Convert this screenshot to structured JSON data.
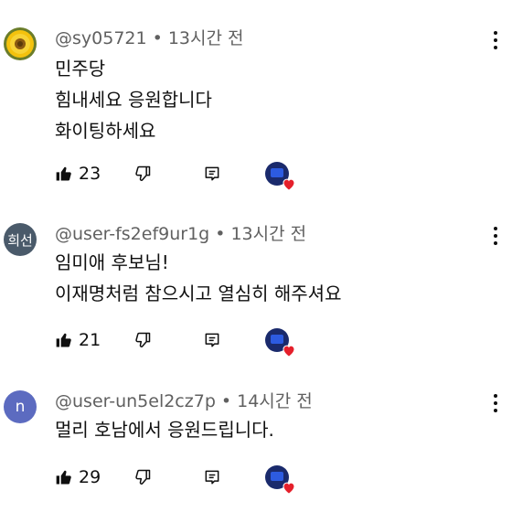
{
  "comments": [
    {
      "handle": "@sy05721",
      "time": "13시간 전",
      "lines": [
        "민주당",
        "힘내세요 응원합니다",
        "화이팅하세요"
      ],
      "likes": "23",
      "avatar": {
        "type": "image",
        "icon": "sunflower-avatar"
      }
    },
    {
      "handle": "@user-fs2ef9ur1g",
      "time": "13시간 전",
      "lines": [
        "임미애 후보님!",
        "이재명처럼 참으시고 열심히 해주셔요"
      ],
      "likes": "21",
      "avatar": {
        "type": "text",
        "text": "희선",
        "color": "#4a5a6a"
      }
    },
    {
      "handle": "@user-un5el2cz7p",
      "time": "14시간 전",
      "lines": [
        "멀리 호남에서 응원드립니다."
      ],
      "likes": "29",
      "avatar": {
        "type": "text",
        "text": "n",
        "color": "#5c6bc0"
      }
    }
  ],
  "separator": "•",
  "colors": {
    "heart": "#e5202b",
    "meta": "#606060",
    "text": "#0f0f0f"
  }
}
